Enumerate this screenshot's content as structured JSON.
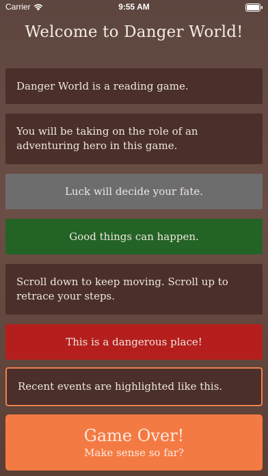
{
  "status_bar": {
    "carrier": "Carrier",
    "time": "9:55 AM"
  },
  "title": "Welcome to Danger World!",
  "cards": [
    {
      "text": "Danger World is a reading game."
    },
    {
      "text": "You will be taking on the role of an adventuring hero in this game."
    },
    {
      "text": "Luck will decide your fate."
    },
    {
      "text": "Good things can happen."
    },
    {
      "text": "Scroll down to keep moving. Scroll up to retrace your steps."
    },
    {
      "text": "This is a dangerous place!"
    },
    {
      "text": "Recent events are highlighted like this."
    }
  ],
  "game_over": {
    "title": "Game Over!",
    "subtitle": "Make sense so far?"
  },
  "colors": {
    "story": "#4a2f2a",
    "neutral": "#6d6d6e",
    "good": "#236326",
    "danger": "#b41f1d",
    "highlight_border": "#f0804f",
    "action": "#f47a43"
  }
}
